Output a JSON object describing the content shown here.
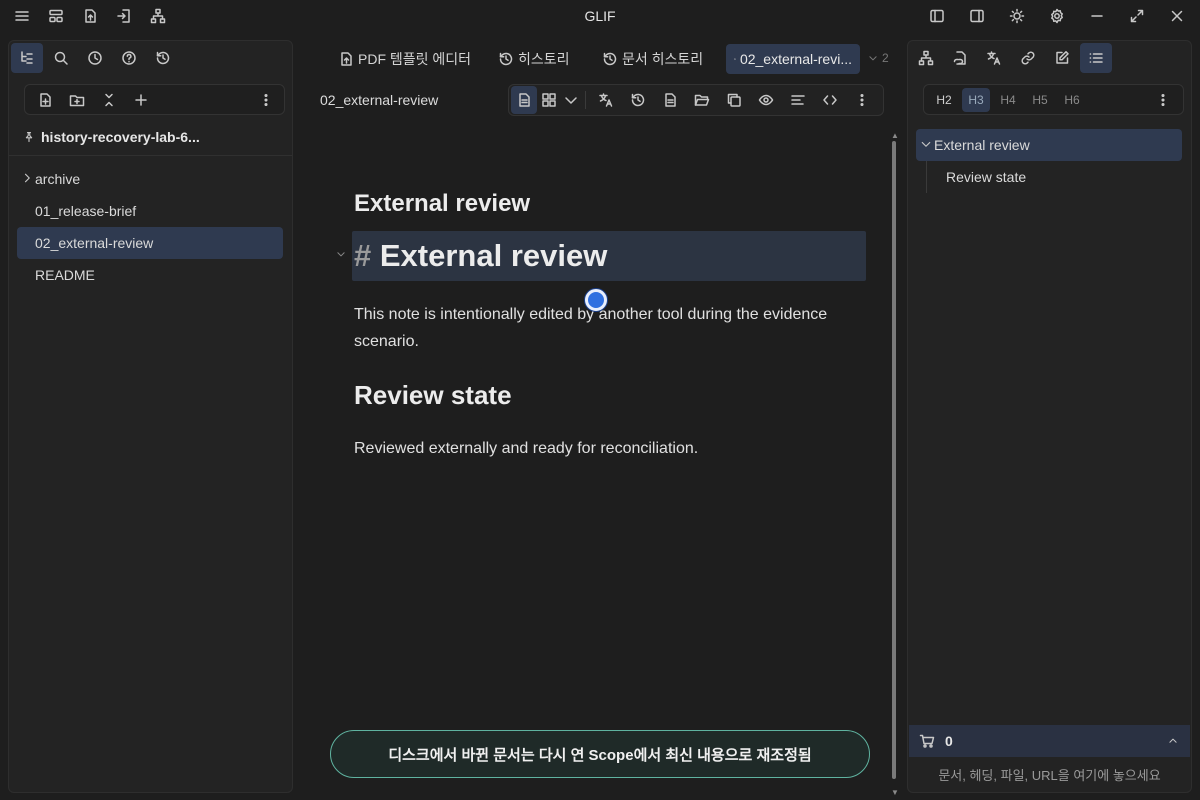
{
  "app": {
    "title": "GLIF"
  },
  "left_panel": {
    "vault_name": "history-recovery-lab-6...",
    "tree": [
      {
        "label": "archive",
        "type": "folder",
        "collapsed": true
      },
      {
        "label": "01_release-brief",
        "type": "file"
      },
      {
        "label": "02_external-review",
        "type": "file",
        "active": true
      },
      {
        "label": "README",
        "type": "file"
      }
    ]
  },
  "tabs": [
    {
      "label": "PDF 템플릿 에디터",
      "icon": "pdf-file-icon"
    },
    {
      "label": "히스토리",
      "icon": "history-icon"
    },
    {
      "label": "문서 히스토리",
      "icon": "history-icon"
    },
    {
      "label": "02_external-revi...",
      "icon": "document-icon",
      "active": true
    }
  ],
  "tab_overflow": "2",
  "view": {
    "title": "02_external-review"
  },
  "document": {
    "inline_title": "External review",
    "h1_hash": "#",
    "h1_text": "External review",
    "paragraph1": "This note is intentionally edited by another tool during the evidence scenario.",
    "h2_text": "Review state",
    "paragraph2": "Reviewed externally and ready for reconciliation."
  },
  "toast": {
    "text": "디스크에서 바뀐 문서는 다시 연 Scope에서 최신 내용으로 재조정됨"
  },
  "right_panel": {
    "heading_levels": [
      "H2",
      "H3",
      "H4",
      "H5",
      "H6"
    ],
    "active_heading_level": "H3",
    "outline": [
      {
        "label": "External review",
        "level": 1
      },
      {
        "label": "Review state",
        "level": 2
      }
    ],
    "basket": {
      "count": "0"
    },
    "dropzone": "문서, 헤딩, 파일, URL을 여기에 놓으세요"
  },
  "colors": {
    "accent_bg": "#2f3a50",
    "toast_border": "#5fb3a0",
    "cursor": "#2f6fe0"
  }
}
